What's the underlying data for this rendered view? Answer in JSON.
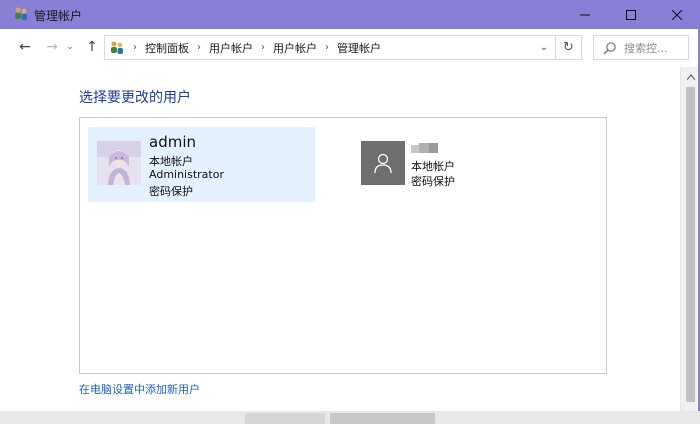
{
  "window": {
    "title": "管理帐户",
    "icon": "control-panel-users-icon",
    "controls": {
      "minimize": "—",
      "maximize": "☐",
      "close": "✕"
    }
  },
  "navigation": {
    "back": "←",
    "forward": "→",
    "recent": "⌄",
    "up": "↑"
  },
  "address": {
    "crumbs": [
      "控制面板",
      "用户帐户",
      "用户帐户",
      "管理帐户"
    ],
    "separator": "›",
    "dropdown": "⌄",
    "refresh": "↻"
  },
  "search": {
    "placeholder": "搜索控..."
  },
  "main": {
    "heading": "选择要更改的用户",
    "add_user_link": "在电脑设置中添加新用户"
  },
  "users": [
    {
      "name": "admin",
      "type": "本地帐户",
      "role": "Administrator",
      "protection": "密码保护",
      "selected": true
    },
    {
      "name": "",
      "type": "本地帐户",
      "protection": "密码保护",
      "avatar": "default-user-icon",
      "selected": false
    }
  ],
  "colors": {
    "titlebar": "#8a7fd6",
    "heading": "#1e3aa8",
    "link": "#1c62c4",
    "selected_tile": "#e3f0fd"
  }
}
